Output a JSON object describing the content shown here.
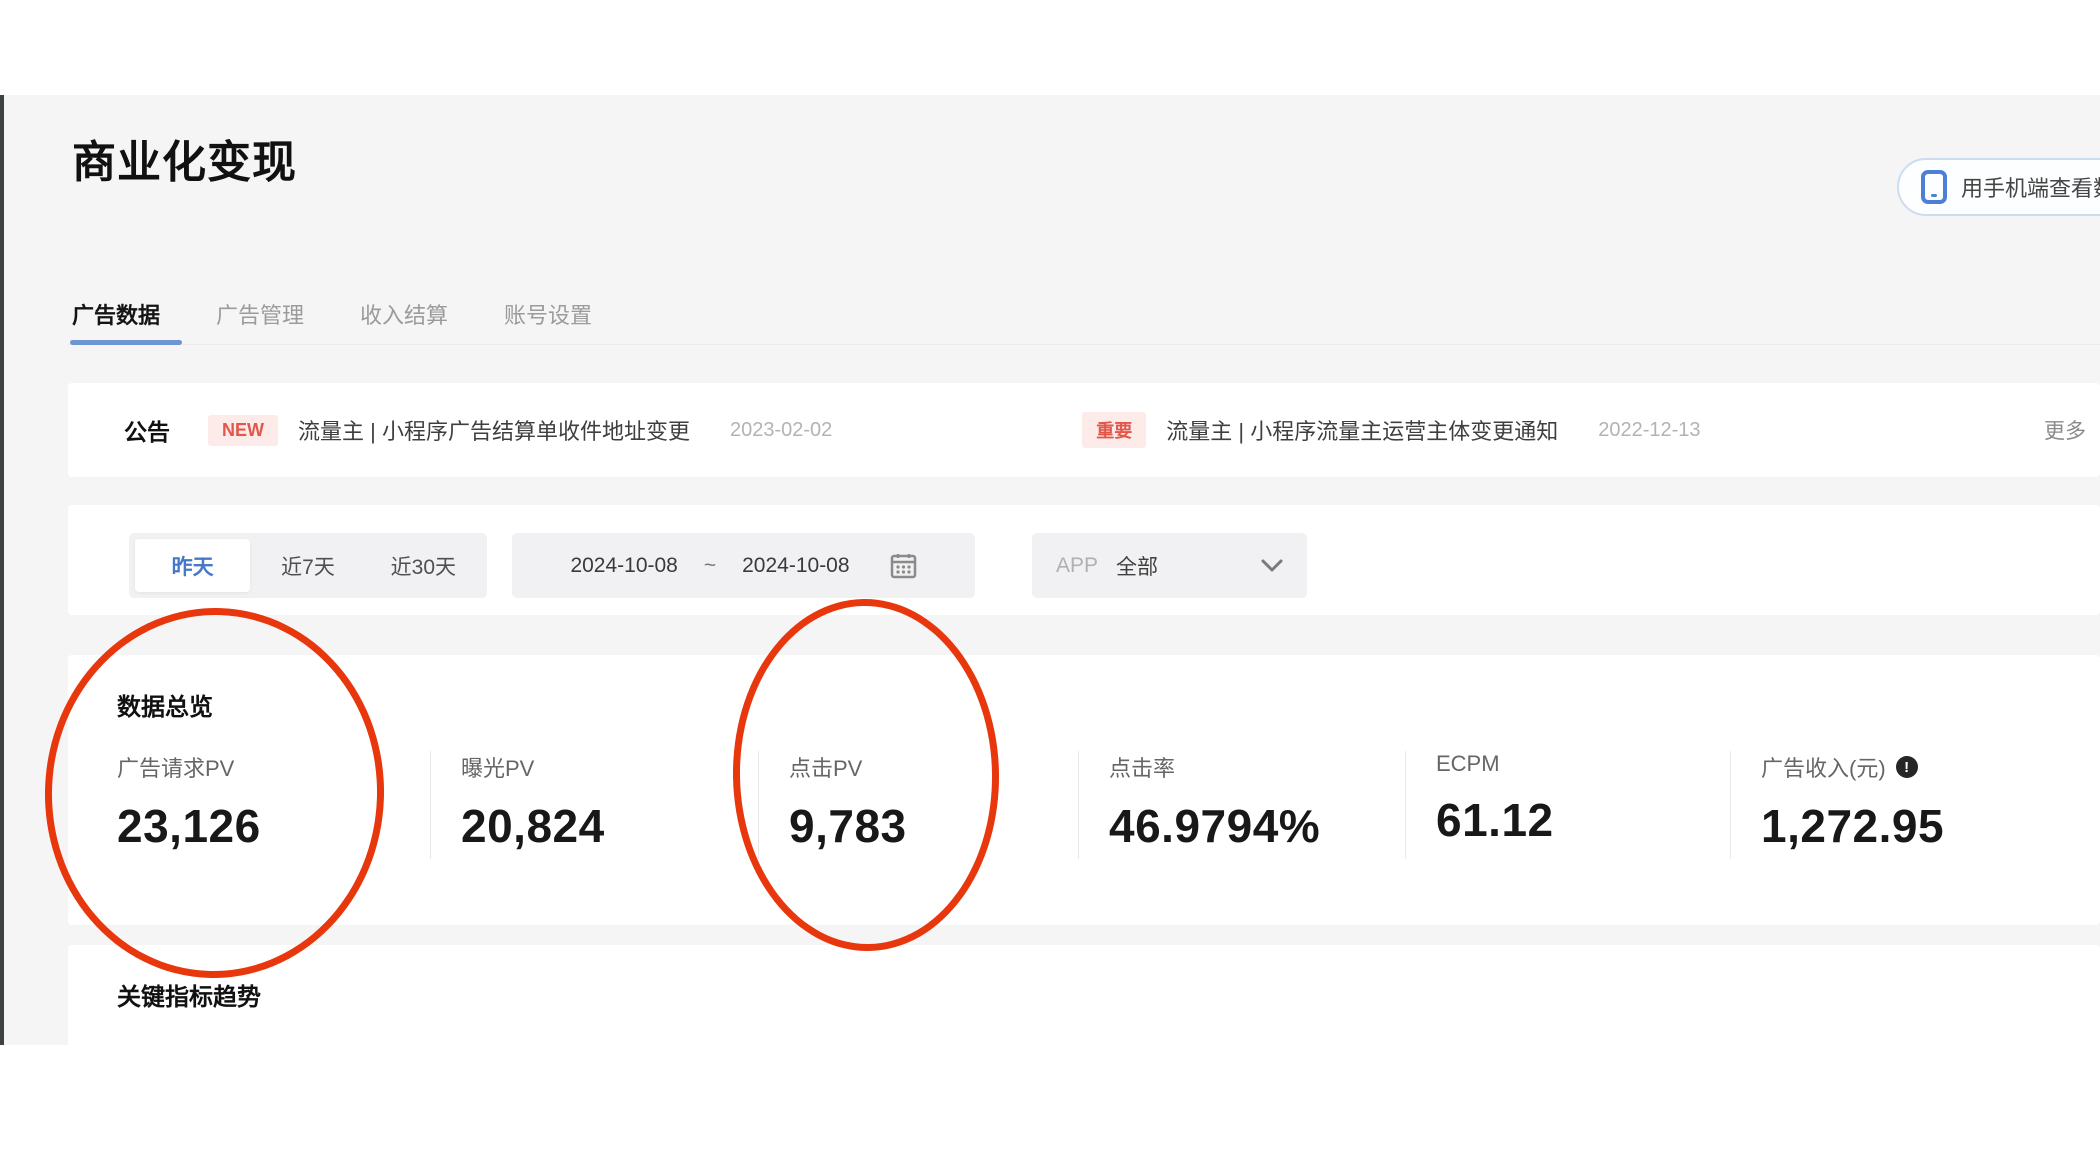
{
  "page": {
    "title": "商业化变现"
  },
  "header": {
    "mobile_button": {
      "label": "用手机端查看数",
      "icon": "phone-icon"
    }
  },
  "tabs": [
    {
      "label": "广告数据",
      "active": true
    },
    {
      "label": "广告管理",
      "active": false
    },
    {
      "label": "收入结算",
      "active": false
    },
    {
      "label": "账号设置",
      "active": false
    }
  ],
  "announcement": {
    "label": "公告",
    "items": [
      {
        "badge": "NEW",
        "title": "流量主 | 小程序广告结算单收件地址变更",
        "date": "2023-02-02"
      },
      {
        "badge": "重要",
        "title": "流量主 | 小程序流量主运营主体变更通知",
        "date": "2022-12-13"
      }
    ],
    "more_label": "更多"
  },
  "filters": {
    "quick_ranges": [
      {
        "label": "昨天",
        "active": true
      },
      {
        "label": "近7天",
        "active": false
      },
      {
        "label": "近30天",
        "active": false
      }
    ],
    "date_range": {
      "start": "2024-10-08",
      "separator": "~",
      "end": "2024-10-08",
      "icon": "calendar-icon"
    },
    "app_filter": {
      "label": "APP",
      "value": "全部",
      "icon": "chevron-down-icon"
    }
  },
  "overview": {
    "title": "数据总览",
    "metrics": [
      {
        "label": "广告请求PV",
        "value": "23,126",
        "circled": true
      },
      {
        "label": "曝光PV",
        "value": "20,824",
        "circled": false
      },
      {
        "label": "点击PV",
        "value": "9,783",
        "circled": true
      },
      {
        "label": "点击率",
        "value": "46.9794%",
        "circled": false
      },
      {
        "label": "ECPM",
        "value": "61.12",
        "circled": false
      },
      {
        "label": "广告收入(元)",
        "value": "1,272.95",
        "circled": false,
        "info_icon": "info-icon"
      }
    ]
  },
  "trend": {
    "title": "关键指标趋势"
  },
  "colors": {
    "accent_blue": "#6d95d2",
    "active_range_blue": "#4678c8",
    "badge_red": "#e25749",
    "badge_bg": "#fcebe9",
    "annotation_red": "#e8370c",
    "page_bg": "#f5f5f6"
  }
}
